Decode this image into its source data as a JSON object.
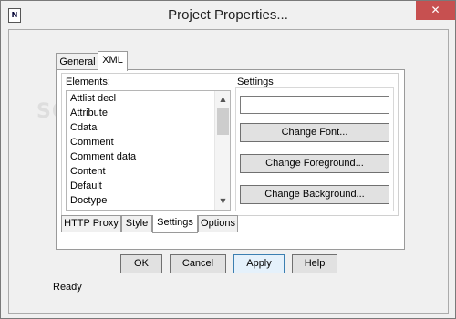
{
  "window": {
    "title": "Project Properties...",
    "app_icon_glyph": "N",
    "close_glyph": "✕"
  },
  "top_tabs": [
    {
      "label": "General",
      "active": false
    },
    {
      "label": "XML",
      "active": true
    }
  ],
  "elements_panel": {
    "label": "Elements:",
    "items": [
      "Attlist decl",
      "Attribute",
      "Cdata",
      "Comment",
      "Comment data",
      "Content",
      "Default",
      "Doctype"
    ]
  },
  "settings_panel": {
    "label": "Settings",
    "text_value": "",
    "change_font_label": "Change Font...",
    "change_foreground_label": "Change Foreground...",
    "change_background_label": "Change Background..."
  },
  "bottom_tabs": [
    {
      "label": "HTTP Proxy",
      "active": false
    },
    {
      "label": "Style",
      "active": false
    },
    {
      "label": "Settings",
      "active": true
    },
    {
      "label": "Options",
      "active": false
    }
  ],
  "dialog_buttons": {
    "ok_label": "OK",
    "cancel_label": "Cancel",
    "apply_label": "Apply",
    "help_label": "Help"
  },
  "status": {
    "text": "Ready"
  },
  "watermark": {
    "text": "SOFTPEDIA"
  },
  "colors": {
    "close_button": "#c75050",
    "default_button_border": "#3c7fb1"
  }
}
